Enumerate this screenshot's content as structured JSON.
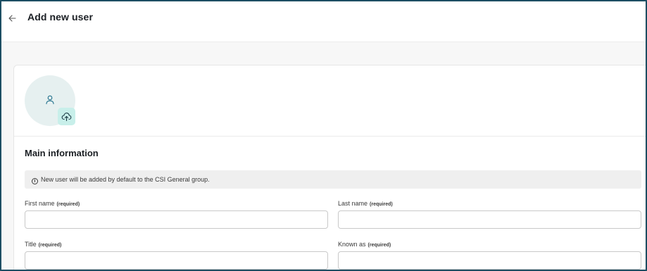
{
  "header": {
    "back_icon": "arrow-left-icon",
    "title": "Add new user"
  },
  "avatar": {
    "placeholder_icon": "person-icon",
    "upload_icon": "cloud-upload-icon"
  },
  "main_information": {
    "title": "Main information",
    "info_icon": "info-circle-icon",
    "banner_text": "New user will be added by default to the CSI General group.",
    "fields": [
      {
        "label": "First name",
        "required_text": "(required)",
        "value": ""
      },
      {
        "label": "Last name",
        "required_text": "(required)",
        "value": ""
      },
      {
        "label": "Title",
        "required_text": "(required)",
        "value": ""
      },
      {
        "label": "Known as",
        "required_text": "(required)",
        "value": ""
      }
    ]
  },
  "colors": {
    "frame_border": "#1d4e63",
    "avatar_bg": "#e6f0f0",
    "upload_bg": "#c8efea",
    "icon_teal": "#1f6f8b"
  }
}
